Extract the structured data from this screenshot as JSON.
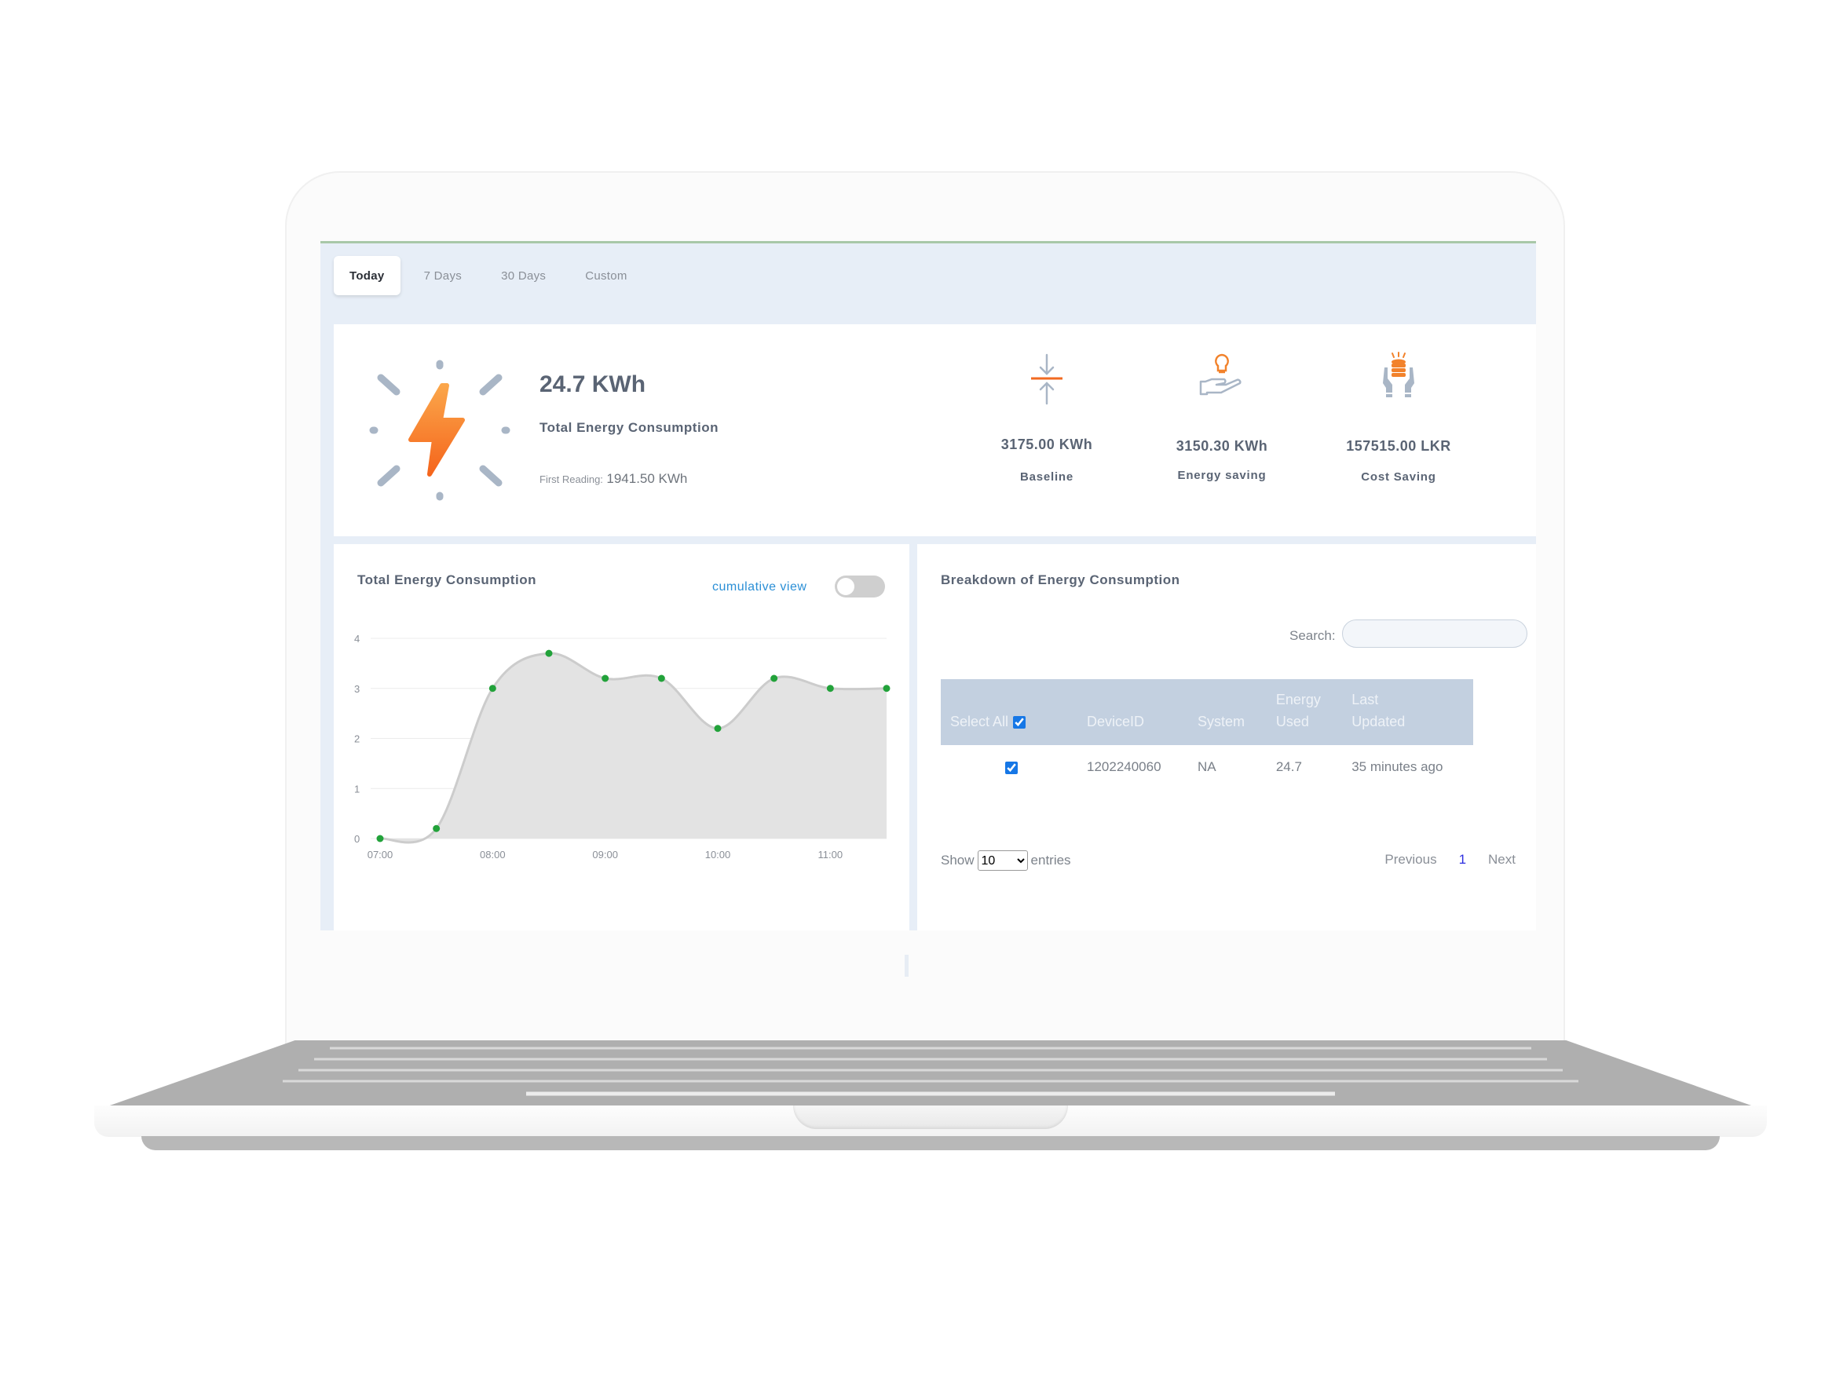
{
  "tabs": [
    {
      "label": "Today",
      "active": true
    },
    {
      "label": "7 Days",
      "active": false
    },
    {
      "label": "30 Days",
      "active": false
    },
    {
      "label": "Custom",
      "active": false
    }
  ],
  "summary": {
    "value": "24.7 KWh",
    "label": "Total Energy Consumption",
    "first_reading_label": "First Reading:",
    "first_reading_value": "1941.50 KWh",
    "icon": "lightning-bolt-icon"
  },
  "stats": [
    {
      "value": "3175.00 KWh",
      "label": "Baseline",
      "icon": "compress-arrows-icon"
    },
    {
      "value": "3150.30 KWh",
      "label": "Energy saving",
      "icon": "hand-bulb-icon"
    },
    {
      "value": "157515.00 LKR",
      "label": "Cost Saving",
      "icon": "hands-coins-icon"
    }
  ],
  "chart_panel": {
    "title": "Total Energy Consumption",
    "toggle_label": "cumulative view",
    "toggle_on": false
  },
  "chart_data": {
    "type": "area",
    "title": "Total Energy Consumption",
    "x": [
      "07:00",
      "07:30",
      "08:00",
      "08:30",
      "09:00",
      "09:30",
      "10:00",
      "10:30",
      "11:00",
      "11:30"
    ],
    "series": [
      {
        "name": "Energy",
        "values": [
          0,
          0.2,
          3.0,
          3.7,
          3.2,
          3.2,
          2.2,
          3.2,
          3.0,
          3.0
        ]
      }
    ],
    "x_tick_labels": [
      "07:00",
      "08:00",
      "09:00",
      "10:00",
      "11:00"
    ],
    "y_ticks": [
      0,
      1,
      2,
      3,
      4
    ],
    "ylim": [
      0,
      4
    ],
    "xlabel": "",
    "ylabel": "",
    "grid": true,
    "colors": {
      "line": "#cccccc",
      "fill": "#e3e3e3",
      "point": "#22a23a"
    }
  },
  "table_panel": {
    "title": "Breakdown of Energy Consumption",
    "search_label": "Search:",
    "search_value": "",
    "columns": {
      "select_all": "Select All",
      "device_id": "DeviceID",
      "system": "System",
      "energy_used": [
        "Energy",
        "Used"
      ],
      "last_updated": [
        "Last",
        "Updated"
      ]
    },
    "rows": [
      {
        "checked": true,
        "device_id": "1202240060",
        "system": "NA",
        "energy_used": "24.7",
        "last_updated": "35 minutes ago"
      }
    ],
    "show_label": "Show",
    "entries_value": "10",
    "entries_label": "entries",
    "pagination": {
      "previous": "Previous",
      "current": "1",
      "next": "Next"
    }
  },
  "colors": {
    "accent_orange": "#f7862a",
    "icon_grey": "#a9b6c6",
    "link_blue": "#2b8fd6",
    "table_header": "#c3d0e0"
  }
}
